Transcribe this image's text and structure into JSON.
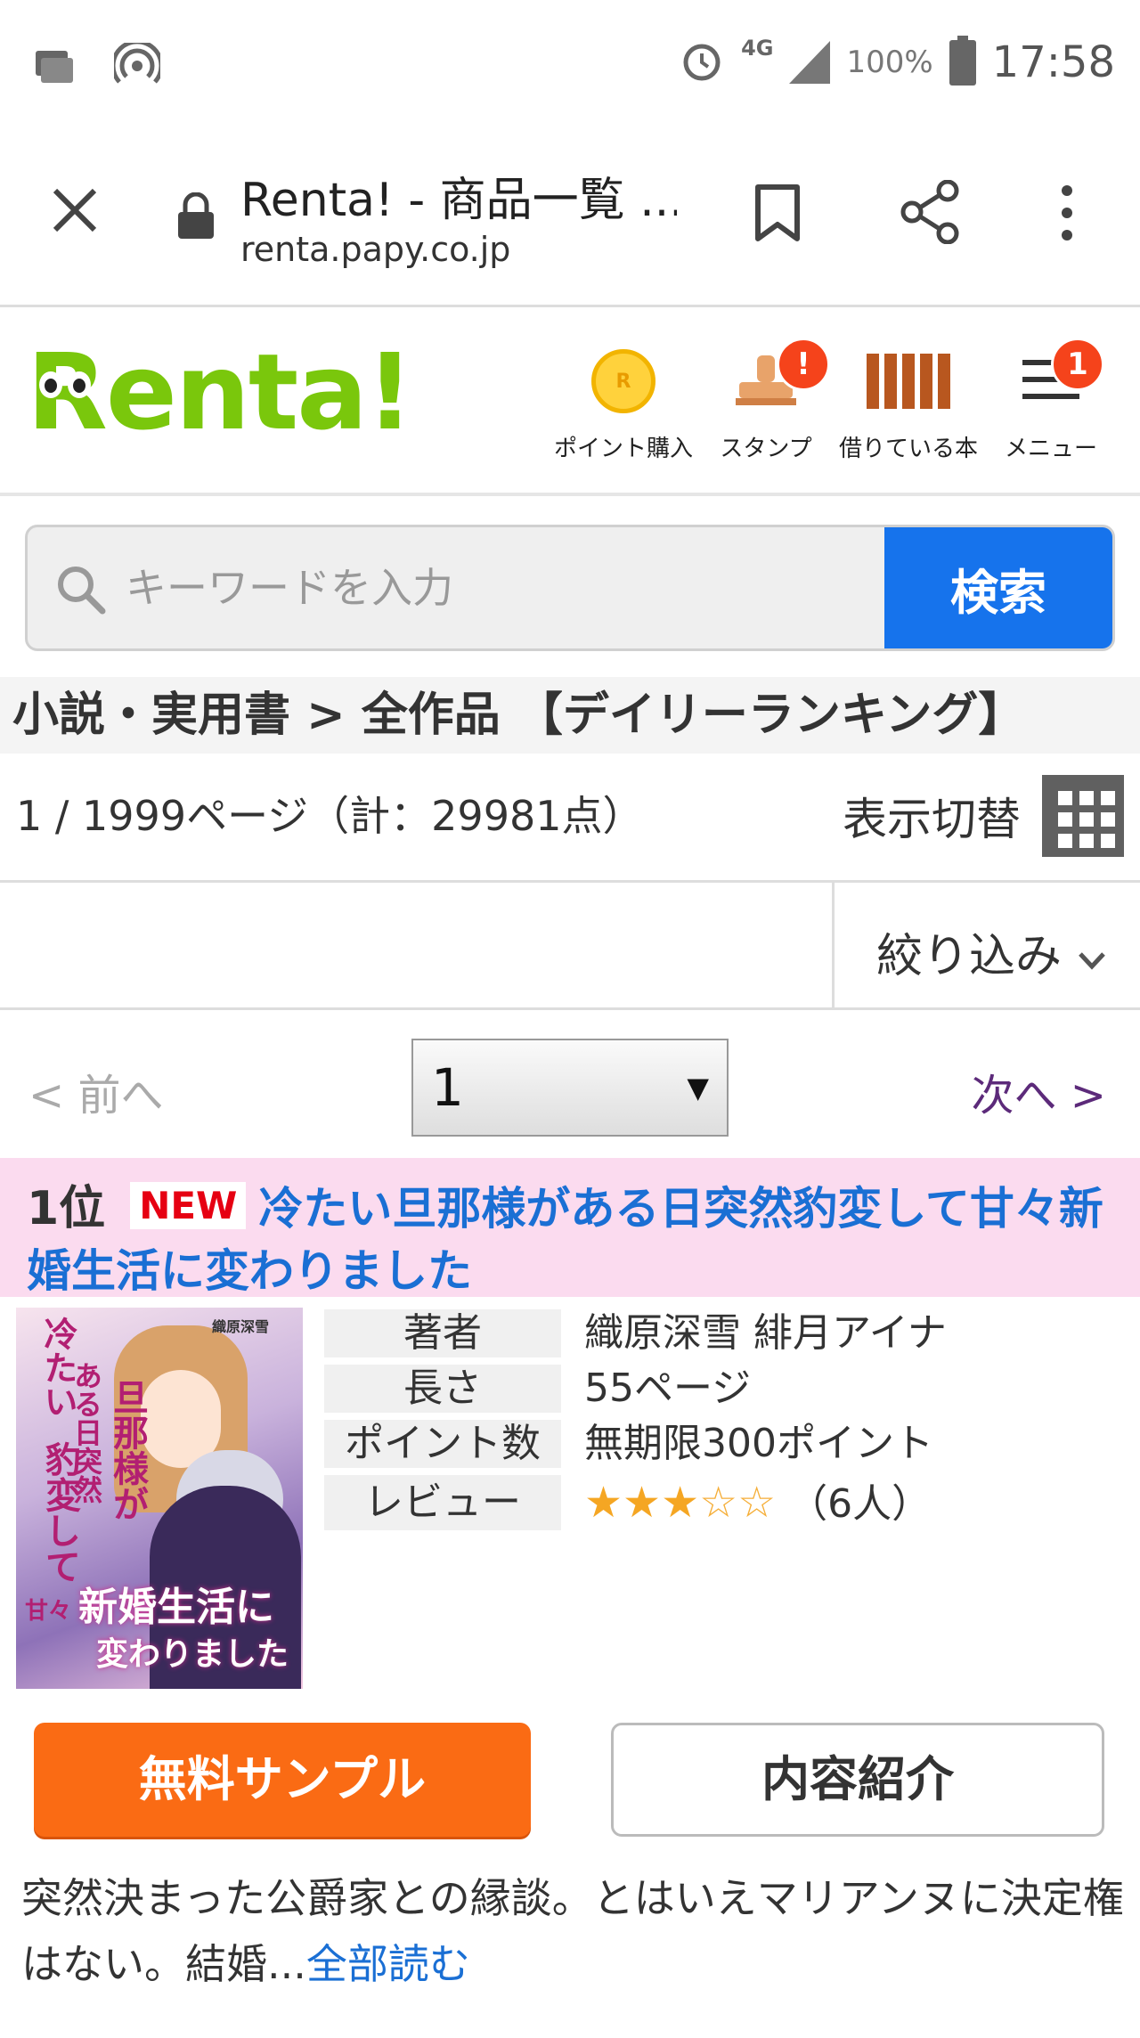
{
  "status_bar": {
    "network": "4G",
    "battery": "100%",
    "time": "17:58",
    "icons": [
      "photo-icon",
      "hotspot-icon",
      "alarm-icon",
      "signal-icon",
      "battery-icon"
    ]
  },
  "browser": {
    "page_title": "Renta! - 商品一覧 ...",
    "url": "renta.papy.co.jp"
  },
  "site": {
    "logo_text": "Renta!",
    "brand_color": "#7ac70c",
    "nav": [
      {
        "label": "ポイント購入",
        "icon": "coin-icon"
      },
      {
        "label": "スタンプ",
        "icon": "stamp-icon",
        "badge": "!"
      },
      {
        "label": "借りている本",
        "icon": "books-icon"
      },
      {
        "label": "メニュー",
        "icon": "menu-icon",
        "badge": "1"
      }
    ]
  },
  "search": {
    "placeholder": "キーワードを入力",
    "button": "検索"
  },
  "breadcrumb": "小説・実用書 > 全作品 【デイリーランキング】",
  "listing": {
    "page_info": "1 / 1999ページ（計：29981点）",
    "view_toggle": "表示切替",
    "filter": "絞り込み",
    "prev": "< 前へ",
    "next": "次へ >",
    "page_select": "1"
  },
  "item": {
    "rank": "1位",
    "new_badge": "NEW",
    "title": "冷たい旦那様がある日突然豹変して甘々新婚生活に変わりました",
    "labels": {
      "author": "著者",
      "length": "長さ",
      "points": "ポイント数",
      "review": "レビュー"
    },
    "author": "織原深雪 緋月アイナ",
    "length": "55ページ",
    "points": "無期限300ポイント",
    "rating": 3,
    "rating_max": 5,
    "review_count": "（6人）",
    "cover_text": {
      "line1": "冷たい",
      "line2": "旦那様が",
      "line3": "ある日突然",
      "line4": "豹変して",
      "line5": "甘々",
      "line6": "新婚生活に",
      "line7": "変わりました",
      "author": "織原深雪"
    },
    "sample_button": "無料サンプル",
    "intro_button": "内容紹介",
    "description": "突然決まった公爵家との縁談。とはいえマリアンヌに決定権はない。結婚...",
    "read_more": "全部読む"
  }
}
